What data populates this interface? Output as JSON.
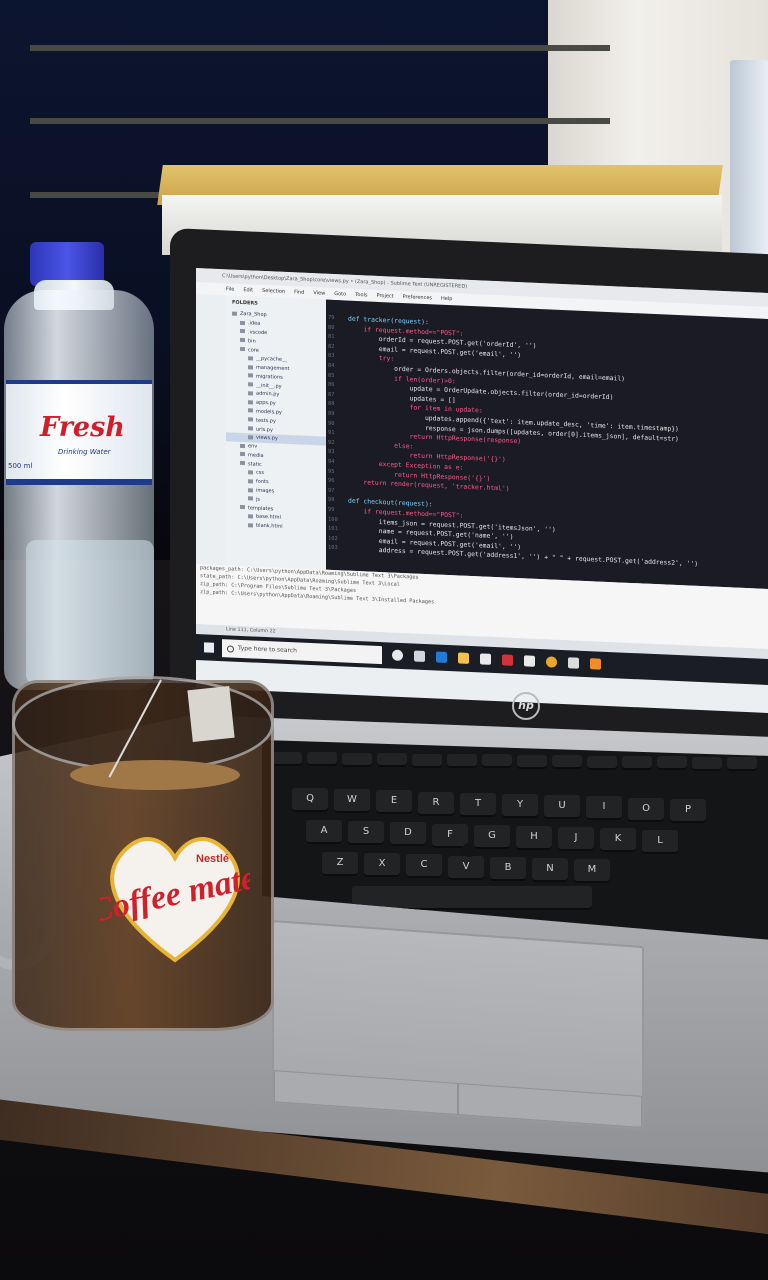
{
  "screen": {
    "window_title": "C:\\Users\\python\\Desktop\\Zara_Shop\\core\\views.py • (Zara_Shop) - Sublime Text (UNREGISTERED)",
    "menu": [
      "File",
      "Edit",
      "Selection",
      "Find",
      "View",
      "Goto",
      "Tools",
      "Project",
      "Preferences",
      "Help"
    ],
    "sidebar": {
      "header": "FOLDERS",
      "items": [
        {
          "label": "Zara_Shop",
          "selected": false
        },
        {
          "label": ".idea",
          "selected": false
        },
        {
          "label": ".vscode",
          "selected": false
        },
        {
          "label": "bin",
          "selected": false
        },
        {
          "label": "core",
          "selected": false
        },
        {
          "label": "__pycache__",
          "selected": false
        },
        {
          "label": "management",
          "selected": false
        },
        {
          "label": "migrations",
          "selected": false
        },
        {
          "label": "__init__.py",
          "selected": false
        },
        {
          "label": "admin.py",
          "selected": false
        },
        {
          "label": "apps.py",
          "selected": false
        },
        {
          "label": "models.py",
          "selected": false
        },
        {
          "label": "tests.py",
          "selected": false
        },
        {
          "label": "urls.py",
          "selected": false
        },
        {
          "label": "views.py",
          "selected": true
        },
        {
          "label": "env",
          "selected": false
        },
        {
          "label": "media",
          "selected": false
        },
        {
          "label": "static",
          "selected": false
        },
        {
          "label": "css",
          "selected": false
        },
        {
          "label": "fonts",
          "selected": false
        },
        {
          "label": "images",
          "selected": false
        },
        {
          "label": "js",
          "selected": false
        },
        {
          "label": "templates",
          "selected": false
        },
        {
          "label": "base.html",
          "selected": false
        },
        {
          "label": "blank.html",
          "selected": false
        }
      ]
    },
    "code": {
      "lines": [
        {
          "n": "79",
          "text": "def tracker(request):"
        },
        {
          "n": "80",
          "text": "    if request.method==\"POST\":"
        },
        {
          "n": "81",
          "text": "        orderId = request.POST.get('orderId', '')"
        },
        {
          "n": "82",
          "text": "        email = request.POST.get('email', '')"
        },
        {
          "n": "83",
          "text": "        try:"
        },
        {
          "n": "84",
          "text": "            order = Orders.objects.filter(order_id=orderId, email=email)"
        },
        {
          "n": "85",
          "text": "            if len(order)>0:"
        },
        {
          "n": "86",
          "text": "                update = OrderUpdate.objects.filter(order_id=orderId)"
        },
        {
          "n": "87",
          "text": "                updates = []"
        },
        {
          "n": "88",
          "text": "                for item in update:"
        },
        {
          "n": "89",
          "text": "                    updates.append({'text': item.update_desc, 'time': item.timestamp})"
        },
        {
          "n": "90",
          "text": "                    response = json.dumps([updates, order[0].items_json], default=str)"
        },
        {
          "n": "91",
          "text": "                return HttpResponse(response)"
        },
        {
          "n": "92",
          "text": "            else:"
        },
        {
          "n": "93",
          "text": "                return HttpResponse('{}')"
        },
        {
          "n": "94",
          "text": "        except Exception as e:"
        },
        {
          "n": "95",
          "text": "            return HttpResponse('{}')"
        },
        {
          "n": "96",
          "text": "    return render(request, 'tracker.html')"
        },
        {
          "n": "97",
          "text": ""
        },
        {
          "n": "98",
          "text": "def checkout(request):"
        },
        {
          "n": "99",
          "text": "    if request.method==\"POST\":"
        },
        {
          "n": "100",
          "text": "        items_json = request.POST.get('itemsJson', '')"
        },
        {
          "n": "101",
          "text": "        name = request.POST.get('name', '')"
        },
        {
          "n": "102",
          "text": "        email = request.POST.get('email', '')"
        },
        {
          "n": "103",
          "text": "        address = request.POST.get('address1', '') + \" \" + request.POST.get('address2', '')"
        }
      ]
    },
    "console": [
      "packages_path: C:\\Users\\python\\AppData\\Roaming\\Sublime Text 3\\Packages",
      "state_path: C:\\Users\\python\\AppData\\Roaming\\Sublime Text 3\\Local",
      "zip_path: C:\\Program Files\\Sublime Text 3\\Packages",
      "zip_path: C:\\Users\\python\\AppData\\Roaming\\Sublime Text 3\\Installed Packages"
    ],
    "status": "Line 111, Column 22",
    "taskbar_search": "Type here to search"
  },
  "laptop_brand": "hp",
  "bottle": {
    "brand": "Fresh",
    "tagline": "Drinking Water",
    "volume": "500 ml"
  },
  "mug": {
    "brand_small": "Nestlé",
    "brand": "Coffee mate"
  },
  "keyboard": {
    "row1": [
      "Q",
      "W",
      "E",
      "R",
      "T",
      "Y",
      "U",
      "I",
      "O",
      "P"
    ],
    "row2": [
      "A",
      "S",
      "D",
      "F",
      "G",
      "H",
      "J",
      "K",
      "L"
    ],
    "row3": [
      "Z",
      "X",
      "C",
      "V",
      "B",
      "N",
      "M"
    ]
  },
  "colors": {
    "bottle_cap": "#3a44d0",
    "bottle_brand": "#d01f2a",
    "mug_logo": "#d11f2b",
    "sublime_bg": "#1b1b24"
  }
}
